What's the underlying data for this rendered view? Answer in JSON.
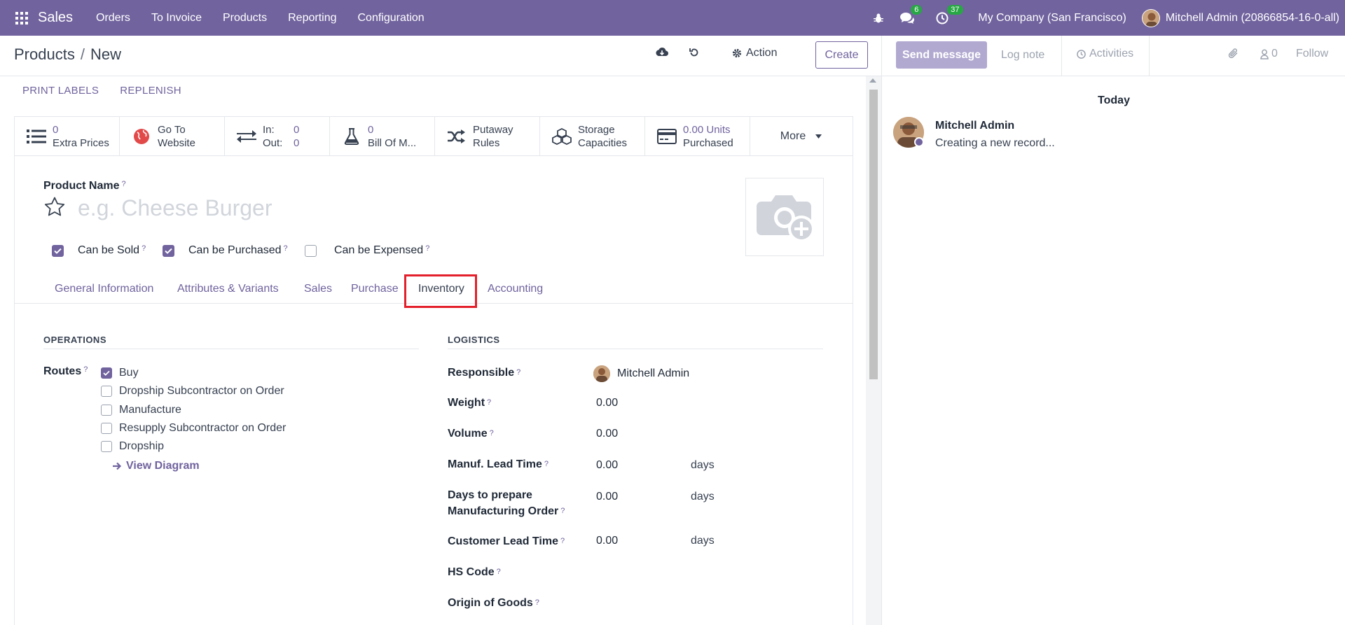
{
  "topbar": {
    "app_name": "Sales",
    "menu": [
      "Orders",
      "To Invoice",
      "Products",
      "Reporting",
      "Configuration"
    ],
    "messages_count": "6",
    "activities_count": "37",
    "company": "My Company (San Francisco)",
    "user": "Mitchell Admin (20866854-16-0-all)"
  },
  "control": {
    "breadcrumb_parent": "Products",
    "breadcrumb_sep": "/",
    "breadcrumb_current": "New",
    "action_label": "Action",
    "create_label": "Create"
  },
  "statusbar": {
    "print_labels": "PRINT LABELS",
    "replenish": "REPLENISH"
  },
  "smart_buttons": {
    "extra_prices_value": "0",
    "extra_prices_label": "Extra Prices",
    "website_line1": "Go To",
    "website_line2": "Website",
    "in_label": "In:",
    "in_value": "0",
    "out_label": "Out:",
    "out_value": "0",
    "bom_value": "0",
    "bom_label": "Bill Of M...",
    "putaway_line1": "Putaway",
    "putaway_line2": "Rules",
    "storage_line1": "Storage",
    "storage_line2": "Capacities",
    "purchased_value": "0.00 Units",
    "purchased_label": "Purchased",
    "more_label": "More"
  },
  "form": {
    "product_name_label": "Product Name",
    "help_mark": "?",
    "product_name_placeholder": "e.g. Cheese Burger",
    "can_be_sold": "Can be Sold",
    "can_be_purchased": "Can be Purchased",
    "can_be_expensed": "Can be Expensed"
  },
  "tabs": [
    "General Information",
    "Attributes & Variants",
    "Sales",
    "Purchase",
    "Inventory",
    "Accounting"
  ],
  "operations": {
    "title": "OPERATIONS",
    "routes_label": "Routes",
    "routes": [
      "Buy",
      "Dropship Subcontractor on Order",
      "Manufacture",
      "Resupply Subcontractor on Order",
      "Dropship"
    ],
    "routes_checked": [
      true,
      false,
      false,
      false,
      false
    ],
    "view_diagram": "View Diagram"
  },
  "logistics": {
    "title": "LOGISTICS",
    "responsible_label": "Responsible",
    "responsible_value": "Mitchell Admin",
    "weight_label": "Weight",
    "weight_value": "0.00",
    "volume_label": "Volume",
    "volume_value": "0.00",
    "manuf_lead_label": "Manuf. Lead Time",
    "manuf_lead_value": "0.00",
    "days_prepare_label_1": "Days to prepare",
    "days_prepare_label_2": "Manufacturing Order",
    "days_prepare_value": "0.00",
    "customer_lead_label": "Customer Lead Time",
    "customer_lead_value": "0.00",
    "hs_code_label": "HS Code",
    "origin_label": "Origin of Goods",
    "days_unit": "days"
  },
  "chatter": {
    "send_message": "Send message",
    "log_note": "Log note",
    "activities": "Activities",
    "followers_count": "0",
    "follow": "Follow",
    "today": "Today",
    "author": "Mitchell Admin",
    "message": "Creating a new record..."
  },
  "colors": {
    "brand": "#71639e",
    "badge": "#28a745",
    "highlight": "#e3202b"
  }
}
